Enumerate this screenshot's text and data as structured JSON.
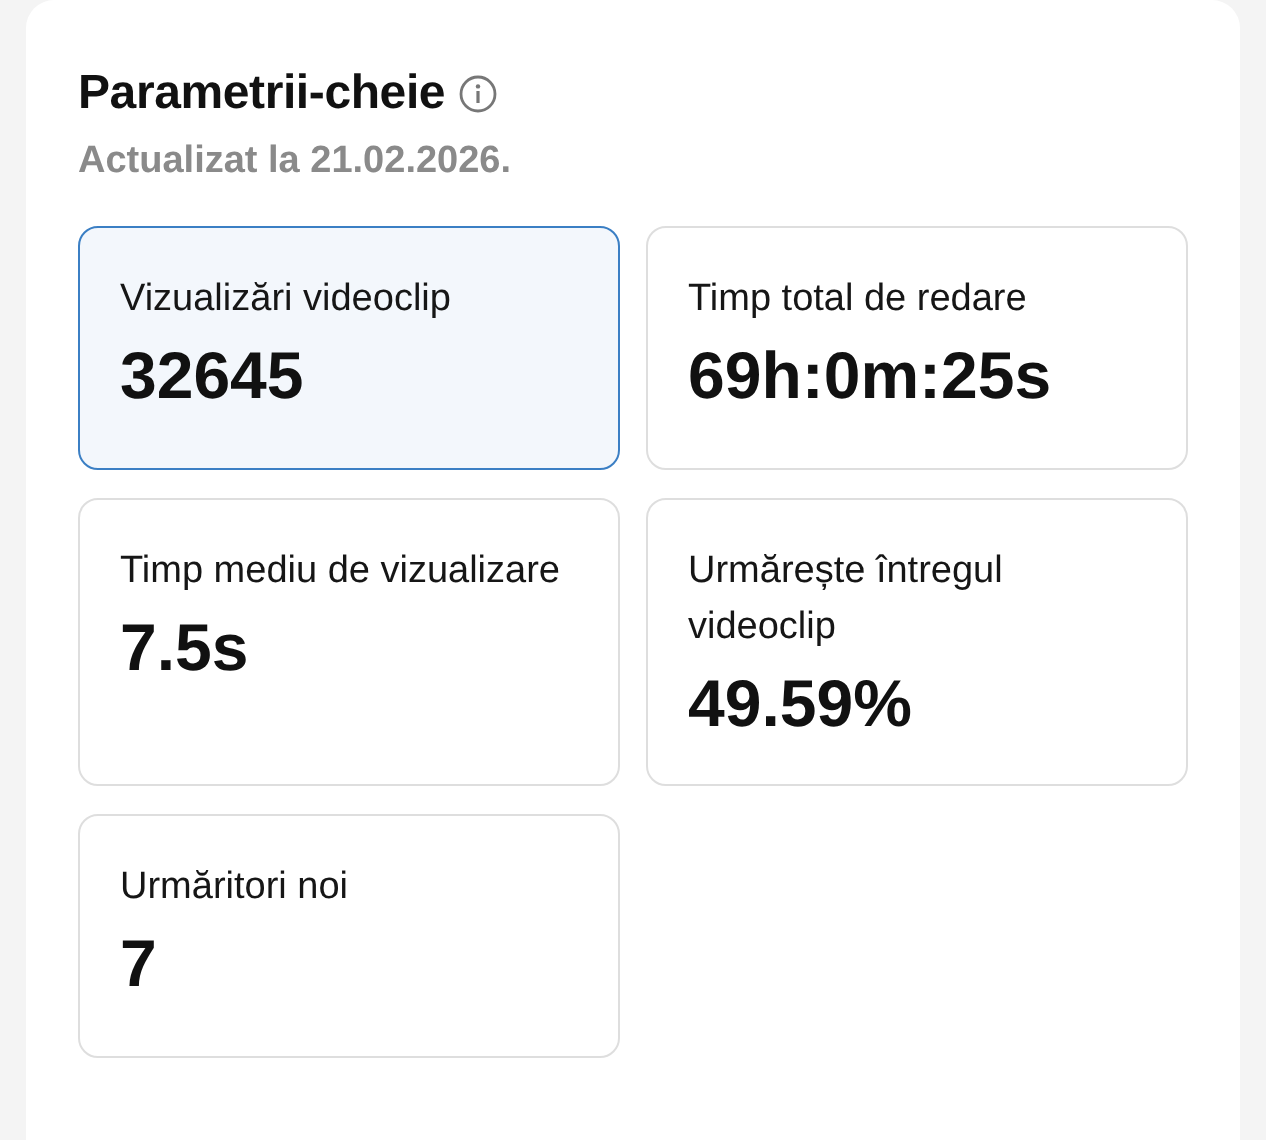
{
  "header": {
    "title": "Parametrii-cheie",
    "subtitle": "Actualizat la 21.02.2026."
  },
  "metrics": [
    {
      "label": "Vizualizări videoclip",
      "value": "32645",
      "selected": true
    },
    {
      "label": "Timp total de redare",
      "value": "69h:0m:25s",
      "selected": false
    },
    {
      "label": "Timp mediu de vizualizare",
      "value": "7.5s",
      "selected": false
    },
    {
      "label": "Urmărește întregul videoclip",
      "value": "49.59%",
      "selected": false
    },
    {
      "label": "Urmăritori noi",
      "value": "7",
      "selected": false
    }
  ]
}
